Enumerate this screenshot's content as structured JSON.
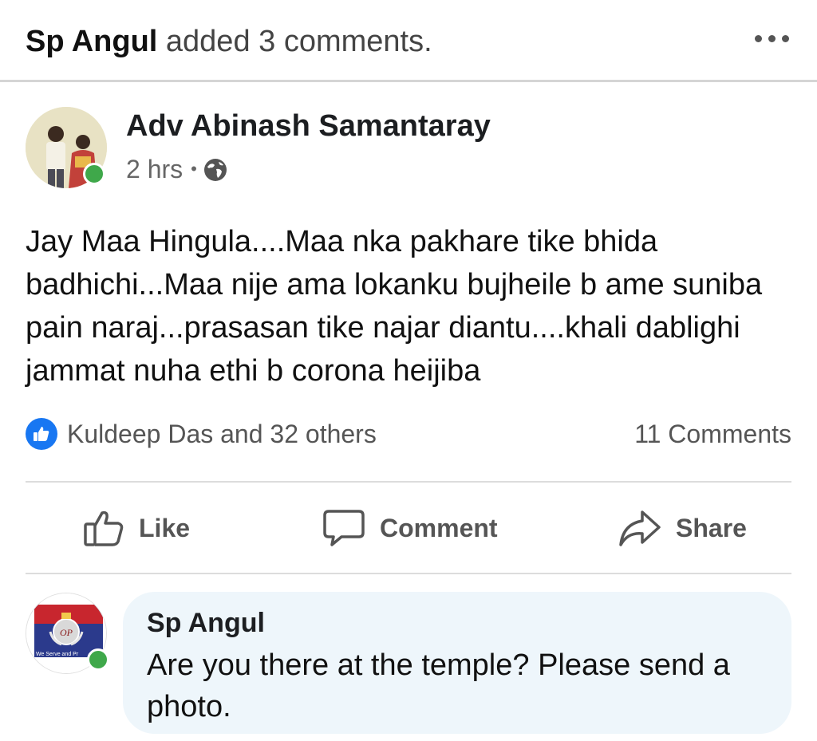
{
  "header": {
    "actor": "Sp Angul",
    "action_text": "added 3 comments.",
    "menu_icon": "more-dots-icon"
  },
  "post": {
    "author": "Adv Abinash Samantaray",
    "time": "2 hrs",
    "separator": "•",
    "privacy_icon": "globe-icon",
    "text": "Jay Maa Hingula....Maa nka pakhare tike bhida badhichi...Maa nije ama lokanku bujheile b ame suniba pain naraj...prasasan tike najar diantu....khali dablighi jammat nuha ethi b corona heijiba"
  },
  "reactions": {
    "summary": "Kuldeep Das and 32 others",
    "comments": "11 Comments",
    "badge_color": "#1877f2"
  },
  "actions": {
    "like": "Like",
    "comment": "Comment",
    "share": "Share"
  },
  "comment": {
    "author": "Sp Angul",
    "text": "Are you there at the temple? Please send a photo.",
    "avatar_caption": "We Serve and Pr"
  },
  "colors": {
    "online": "#3fa84a",
    "bubble": "#eef6fb"
  }
}
